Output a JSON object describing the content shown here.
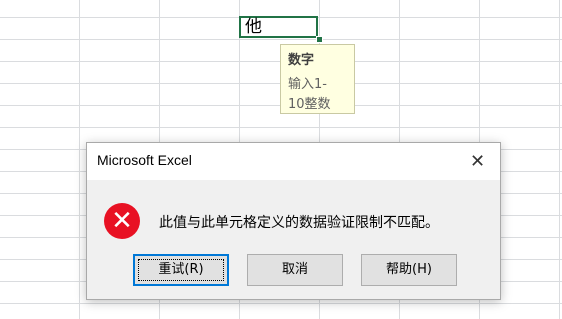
{
  "cell": {
    "value": "他"
  },
  "tooltip": {
    "title": "数字",
    "body_line1": "输入1-",
    "body_line2": "10整数"
  },
  "dialog": {
    "title": "Microsoft Excel",
    "close": "✕",
    "icon_symbol": "✕",
    "message": "此值与此单元格定义的数据验证限制不匹配。",
    "buttons": {
      "retry": "重试(R)",
      "cancel": "取消",
      "help": "帮助(H)"
    }
  },
  "colors": {
    "cell_border": "#217346",
    "tooltip_bg": "#ffffe1",
    "error_red": "#e81123",
    "focus_blue": "#0078d7"
  },
  "icons": [
    "close-icon",
    "error-icon"
  ]
}
